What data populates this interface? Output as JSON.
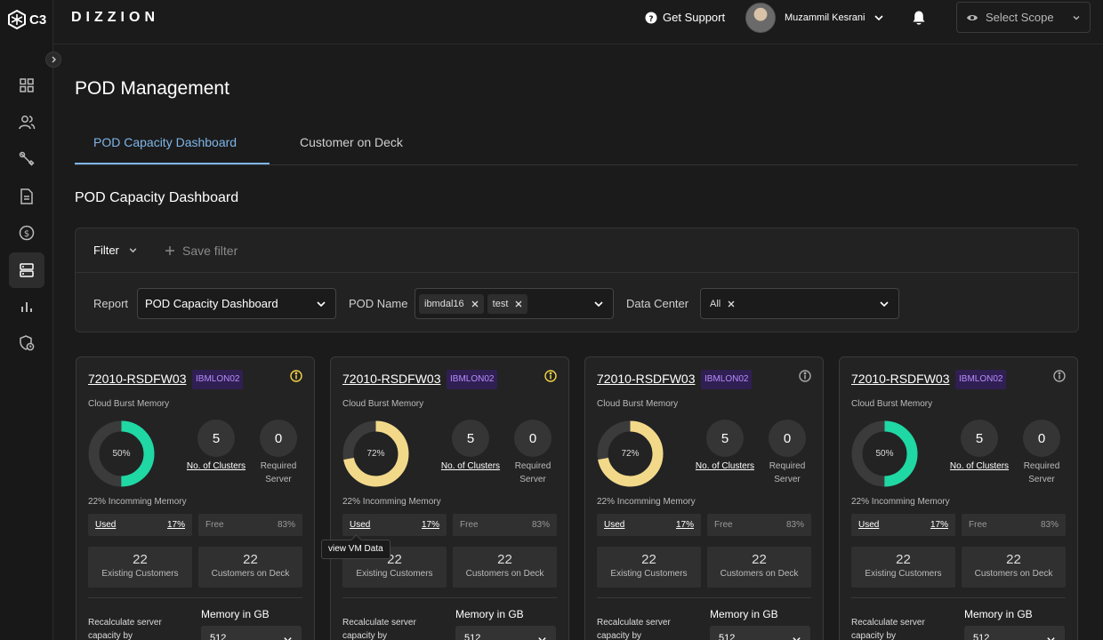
{
  "app": {
    "logo": "C3",
    "brand": "DIZZION"
  },
  "header": {
    "support_label": "Get Support",
    "user_name": "Muzammil Kesrani",
    "scope_placeholder": "Select Scope"
  },
  "sidebar": {
    "items": [
      {
        "icon": "grid-icon"
      },
      {
        "icon": "users-icon"
      },
      {
        "icon": "wrench-icon"
      },
      {
        "icon": "document-icon"
      },
      {
        "icon": "dollar-icon"
      },
      {
        "icon": "server-icon",
        "active": true
      },
      {
        "icon": "bar-chart-icon"
      },
      {
        "icon": "shield-clock-icon"
      }
    ]
  },
  "page": {
    "title": "POD Management",
    "tabs": [
      "POD Capacity Dashboard",
      "Customer on Deck"
    ],
    "section_title": "POD Capacity Dashboard"
  },
  "filters": {
    "filter_label": "Filter",
    "save_filter_label": "Save filter",
    "report_label": "Report",
    "report_value": "POD Capacity Dashboard",
    "pod_label": "POD Name",
    "pod_chips": [
      "ibmdal16",
      "test"
    ],
    "dc_label": "Data Center",
    "dc_chips": [
      "All"
    ]
  },
  "card_labels": {
    "cloud_burst": "Cloud Burst Memory",
    "clusters": "No. of Clusters",
    "required": "Required Server",
    "used": "Used",
    "free": "Free",
    "existing": "Existing Customers",
    "on_deck": "Customers on Deck",
    "recalc": "Recalculate server capacity by",
    "memory": "Memory in GB"
  },
  "cards": [
    {
      "title": "72010-RSDFW03",
      "badge": "IBMLON02",
      "alert": true,
      "percent": 50,
      "percent_label": "50%",
      "color": "#1fd8a4",
      "clusters": "5",
      "required": "0",
      "incoming": "22% Incomming Memory",
      "used_pct": "17%",
      "free_pct": "83%",
      "existing": "22",
      "on_deck": "22",
      "memory": "512"
    },
    {
      "title": "72010-RSDFW03",
      "badge": "IBMLON02",
      "alert": true,
      "percent": 72,
      "percent_label": "72%",
      "color": "#f2d98a",
      "clusters": "5",
      "required": "0",
      "incoming": "22% Incomming Memory",
      "used_pct": "17%",
      "free_pct": "83%",
      "existing": "22",
      "on_deck": "22",
      "memory": "512"
    },
    {
      "title": "72010-RSDFW03",
      "badge": "IBMLON02",
      "alert": false,
      "percent": 72,
      "percent_label": "72%",
      "color": "#f2d98a",
      "clusters": "5",
      "required": "0",
      "incoming": "22% Incomming Memory",
      "used_pct": "17%",
      "free_pct": "83%",
      "existing": "22",
      "on_deck": "22",
      "memory": "512"
    },
    {
      "title": "72010-RSDFW03",
      "badge": "IBMLON02",
      "alert": false,
      "percent": 50,
      "percent_label": "50%",
      "color": "#1fd8a4",
      "clusters": "5",
      "required": "0",
      "incoming": "22% Incomming Memory",
      "used_pct": "17%",
      "free_pct": "83%",
      "existing": "22",
      "on_deck": "22",
      "memory": "512"
    }
  ],
  "tooltip": "view VM Data",
  "colors": {
    "accent": "#7eb6ea",
    "alert": "#f5d547",
    "badge_bg": "#2f1f52",
    "badge_text": "#b98cff"
  }
}
